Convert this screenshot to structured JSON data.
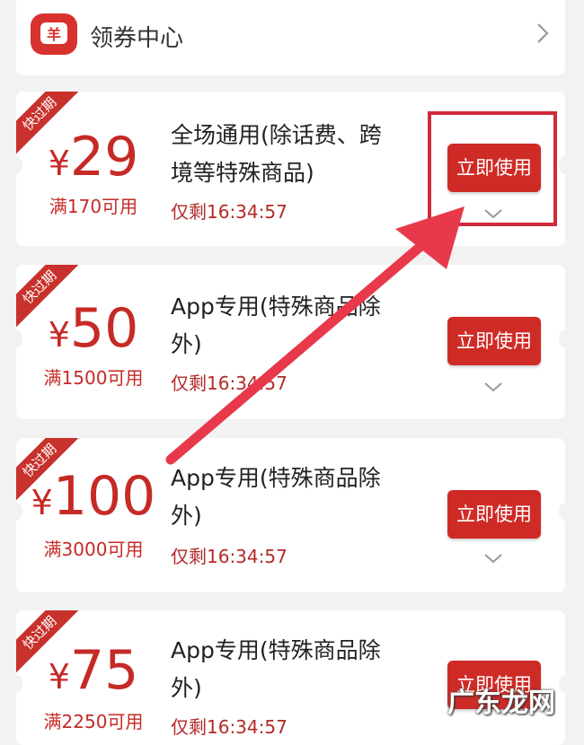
{
  "header": {
    "icon_glyph": "羊",
    "title": "领券中心",
    "chevron": "chevron-right-icon"
  },
  "coupons": [
    {
      "ribbon": "快过期",
      "currency": "¥",
      "amount": "29",
      "condition": "满170可用",
      "description": [
        "全场通用(除话费、跨",
        "境等特殊商品)"
      ],
      "remaining": "仅剩16:34:57",
      "button": "立即使用"
    },
    {
      "ribbon": "快过期",
      "currency": "¥",
      "amount": "50",
      "condition": "满1500可用",
      "description": [
        "App专用(特殊商品除",
        "外)"
      ],
      "remaining": "仅剩16:34:57",
      "button": "立即使用"
    },
    {
      "ribbon": "快过期",
      "currency": "¥",
      "amount": "100",
      "condition": "满3000可用",
      "description": [
        "App专用(特殊商品除",
        "外)"
      ],
      "remaining": "仅剩16:34:57",
      "button": "立即使用"
    },
    {
      "ribbon": "快过期",
      "currency": "¥",
      "amount": "75",
      "condition": "满2250可用",
      "description": [
        "App专用(特殊商品除",
        "外)"
      ],
      "remaining": "仅剩16:34:57",
      "button": "立即使用"
    }
  ],
  "annotation": {
    "box_color": "#cf2b3a",
    "arrow_color": "#e8394b"
  },
  "watermark": "广东龙网",
  "colors": {
    "accent": "#cf2b26",
    "amount_text": "#c62a26",
    "background": "#f2f2f2"
  }
}
